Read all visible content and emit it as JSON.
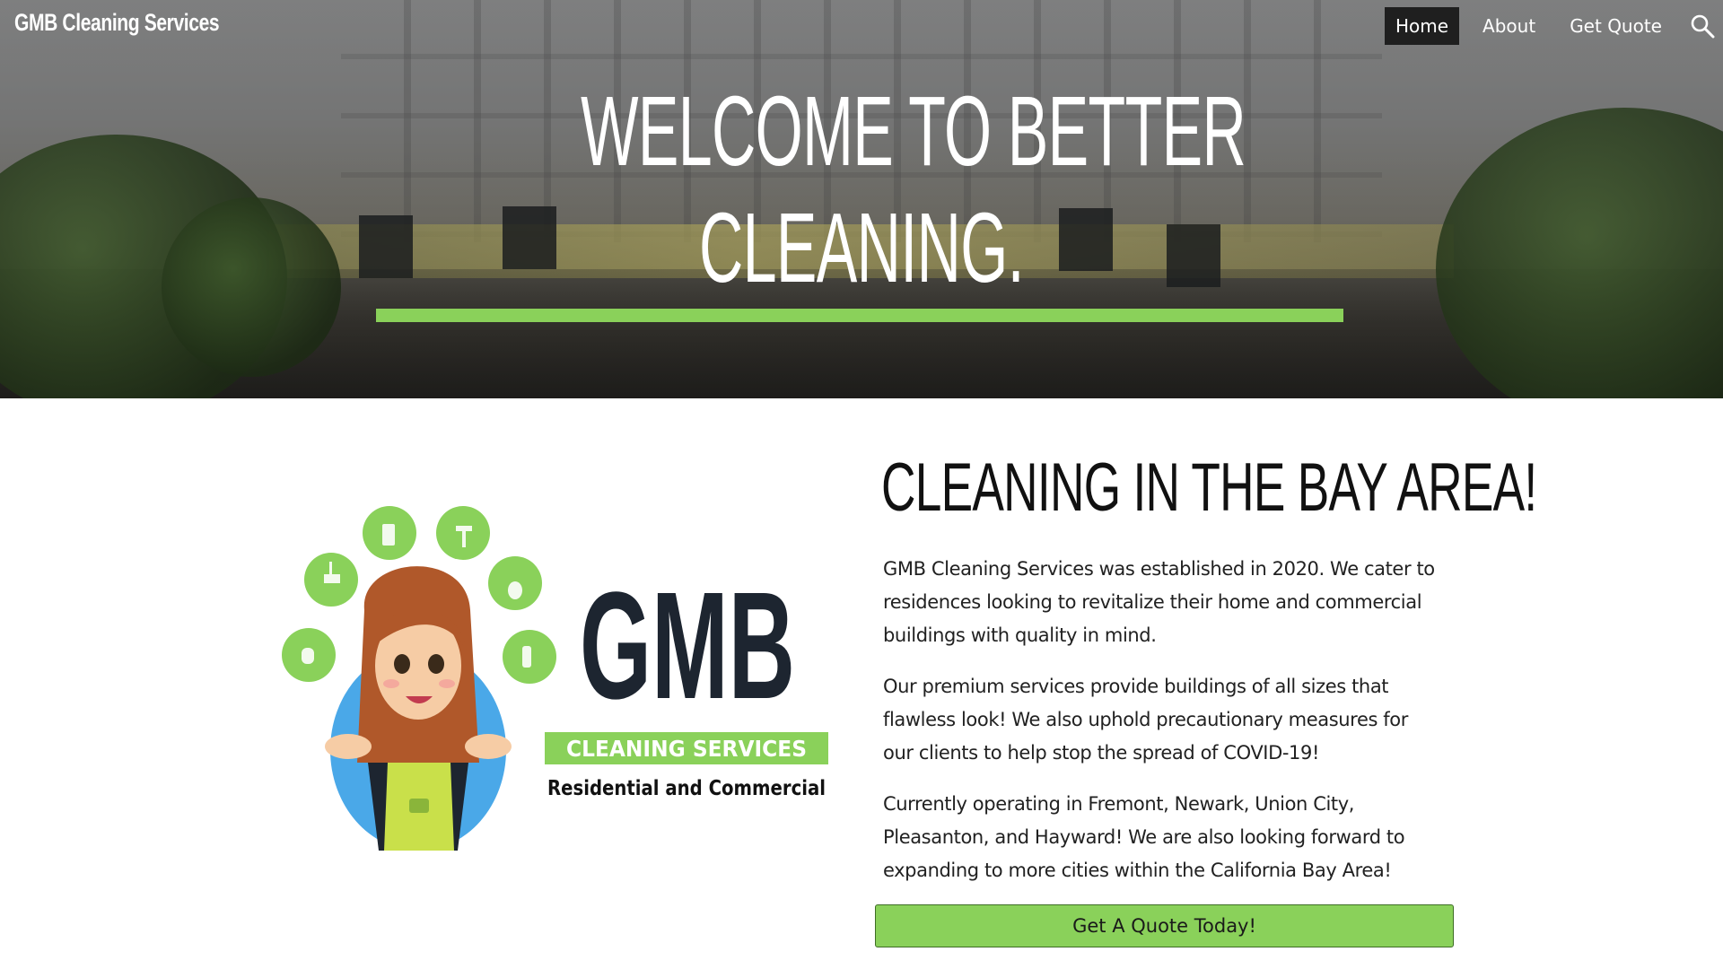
{
  "header": {
    "site_title": "GMB Cleaning Services",
    "nav": [
      {
        "label": "Home",
        "active": true
      },
      {
        "label": "About",
        "active": false
      },
      {
        "label": "Get Quote",
        "active": false
      }
    ],
    "search_icon": "search-icon"
  },
  "hero": {
    "heading_line1": "WELCOME TO BETTER",
    "heading_line2": "CLEANING.",
    "accent_color": "#8ad15a"
  },
  "logo": {
    "wordmark": "GMB",
    "banner": "CLEANING SERVICES",
    "tagline": "Residential and Commercial",
    "colors": {
      "green": "#8ad15a",
      "navy": "#1d2530",
      "blue": "#4aa8e8"
    }
  },
  "main": {
    "title": "CLEANING IN THE BAY AREA!",
    "paragraphs": [
      "GMB Cleaning Services was established in 2020. We cater to residences looking to revitalize their home and commercial buildings with quality in mind.",
      "Our premium services provide buildings of all sizes that flawless look! We also uphold precautionary measures for our clients to help stop the spread of COVID-19!",
      "Currently operating in Fremont, Newark, Union City, Pleasanton, and Hayward! We are also looking forward to expanding to more cities within the California Bay Area!"
    ],
    "cta_label": "Get A Quote Today!"
  }
}
